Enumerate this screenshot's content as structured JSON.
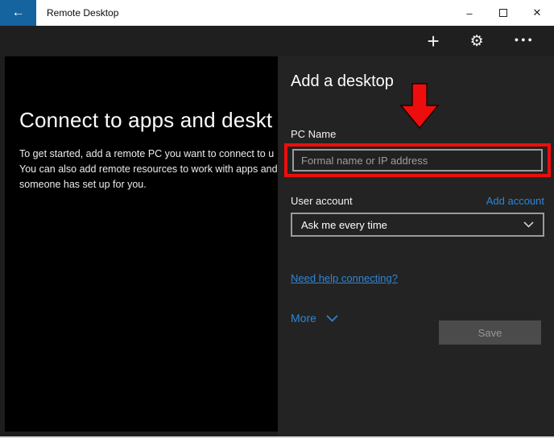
{
  "window": {
    "title": "Remote Desktop",
    "icons": {
      "back": "←",
      "minimize": "–",
      "close": "✕"
    }
  },
  "toolbar": {
    "icons": {
      "add": "+",
      "settings": "⚙",
      "more": "●●●"
    }
  },
  "main": {
    "heading": "Connect to apps and deskt",
    "body_lines": [
      "To get started, add a remote PC you want to connect to u",
      "You can also add remote resources to work with apps and",
      "someone has set up for you."
    ]
  },
  "panel": {
    "title": "Add a desktop",
    "pc_name": {
      "label": "PC Name",
      "placeholder": "Formal name or IP address",
      "value": ""
    },
    "user_account": {
      "label": "User account",
      "add_account_link": "Add account",
      "selected_value": "Ask me every time"
    },
    "help_link": "Need help connecting?",
    "more_label": "More",
    "save_label": "Save"
  },
  "colors": {
    "accent_blue": "#15639f",
    "link_blue": "#2e86d6",
    "highlight_red": "#ee0d0d",
    "panel_bg": "#232323",
    "content_bg": "#000000"
  }
}
